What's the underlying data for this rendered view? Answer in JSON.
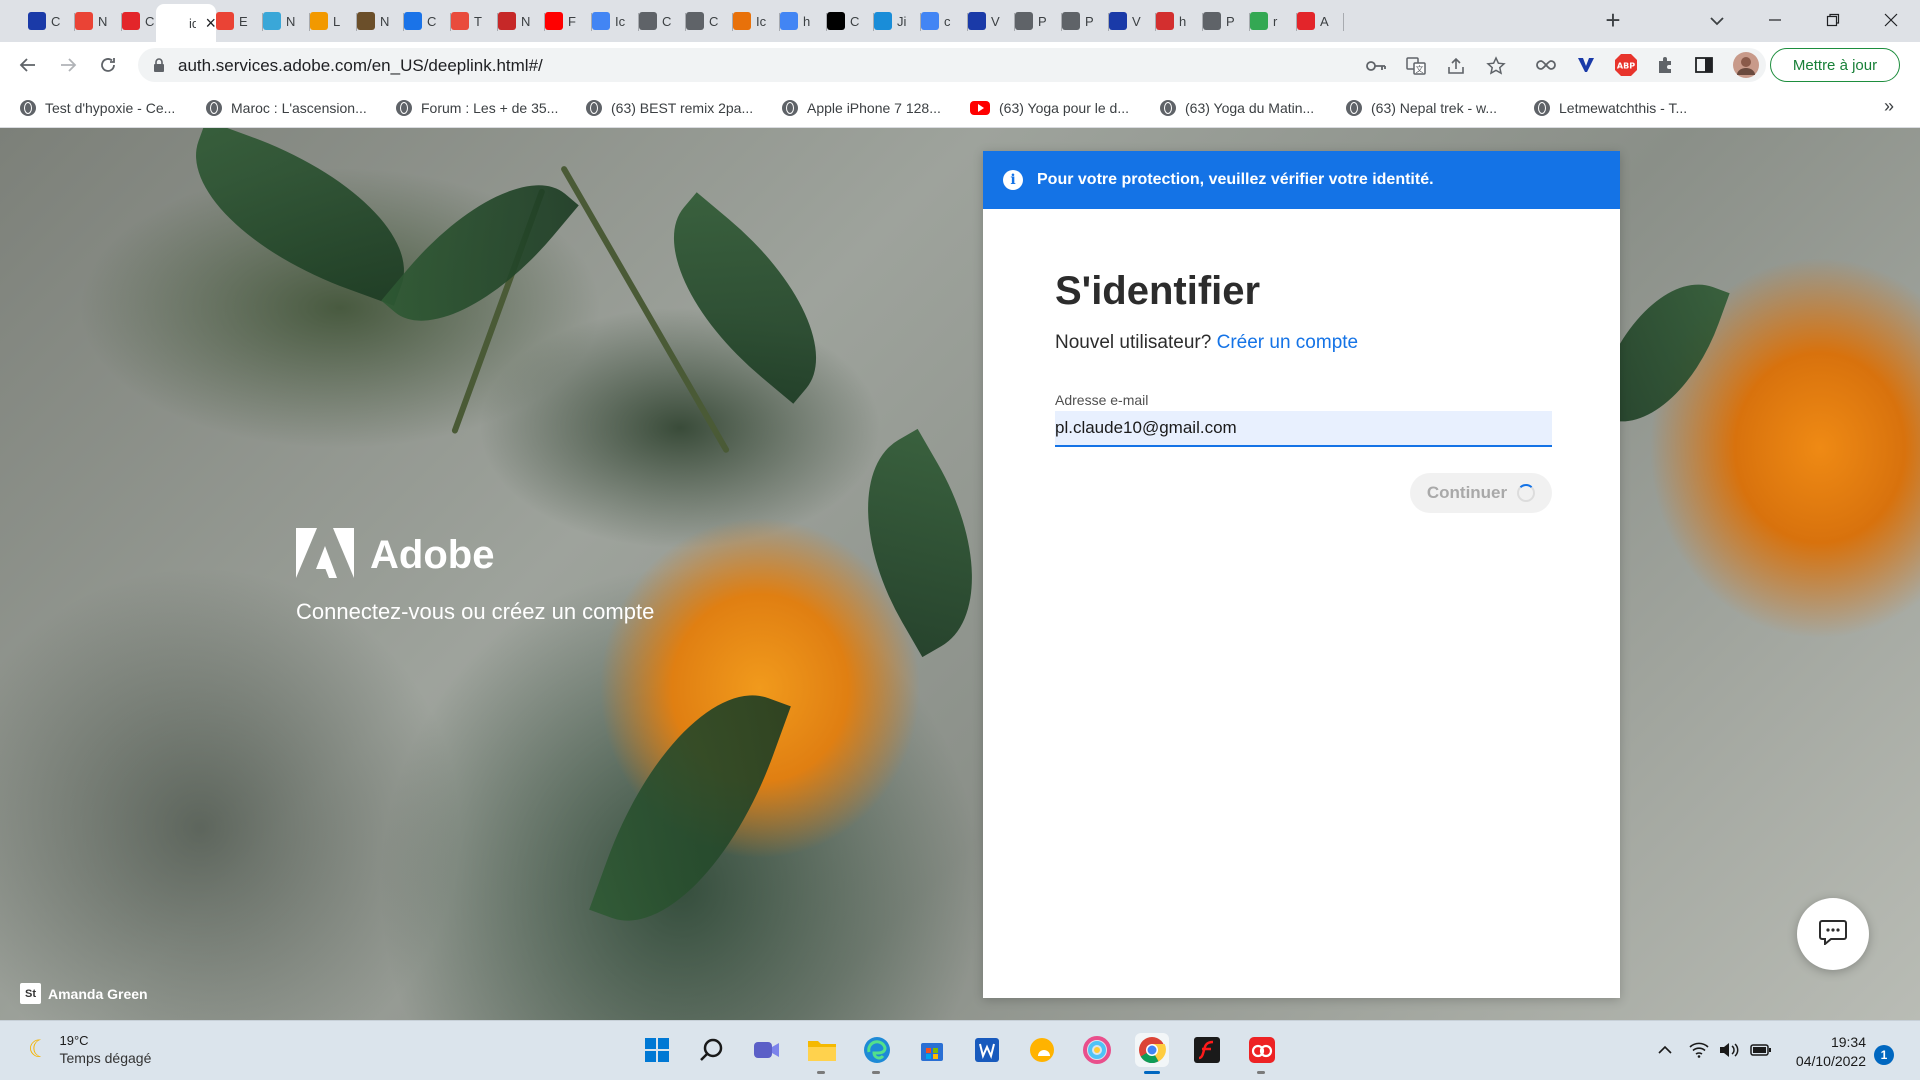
{
  "browser": {
    "tabs": [
      {
        "favicon": "veed-icon",
        "title": "C",
        "color": "#1a3aa8"
      },
      {
        "favicon": "gmail-icon",
        "title": "N",
        "color": "#ea4335"
      },
      {
        "favicon": "adobe-icon",
        "title": "C",
        "color": "#e3252a"
      },
      {
        "favicon": "text-icon",
        "title": "id",
        "color": "#ffffff",
        "active": true
      },
      {
        "favicon": "gmail-icon",
        "title": "E",
        "color": "#ea4335"
      },
      {
        "favicon": "plus-cross-icon",
        "title": "N",
        "color": "#3aa7d8"
      },
      {
        "favicon": "pencil-icon",
        "title": "L",
        "color": "#f29900"
      },
      {
        "favicon": "tree-icon",
        "title": "N",
        "color": "#6b4f2a"
      },
      {
        "favicon": "calendar-icon",
        "title": "C",
        "color": "#1a73e8"
      },
      {
        "favicon": "heart-icon",
        "title": "T",
        "color": "#e94b3c"
      },
      {
        "favicon": "swirl-icon",
        "title": "N",
        "color": "#c62828"
      },
      {
        "favicon": "youtube-icon",
        "title": "F",
        "color": "#ff0000"
      },
      {
        "favicon": "google-icon",
        "title": "Ic",
        "color": "#4285f4"
      },
      {
        "favicon": "ign-icon",
        "title": "C",
        "color": "#5f6368"
      },
      {
        "favicon": "ign-icon",
        "title": "C",
        "color": "#5f6368"
      },
      {
        "favicon": "image-icon",
        "title": "Ic",
        "color": "#e8710a"
      },
      {
        "favicon": "google-icon",
        "title": "h",
        "color": "#4285f4"
      },
      {
        "favicon": "wix-icon",
        "title": "C",
        "color": "#000000"
      },
      {
        "favicon": "five-icon",
        "title": "Ji",
        "color": "#1a8dd8"
      },
      {
        "favicon": "google-icon",
        "title": "c",
        "color": "#4285f4"
      },
      {
        "favicon": "veed-icon",
        "title": "V",
        "color": "#1a3aa8"
      },
      {
        "favicon": "globe-icon",
        "title": "P",
        "color": "#5f6368"
      },
      {
        "favicon": "globe-icon",
        "title": "P",
        "color": "#5f6368"
      },
      {
        "favicon": "veed-icon",
        "title": "V",
        "color": "#1a3aa8"
      },
      {
        "favicon": "flag-icon",
        "title": "h",
        "color": "#d32f2f"
      },
      {
        "favicon": "globe-icon",
        "title": "P",
        "color": "#5f6368"
      },
      {
        "favicon": "maps-icon",
        "title": "r",
        "color": "#34a853"
      },
      {
        "favicon": "adobe-icon",
        "title": "A",
        "color": "#e3252a"
      }
    ],
    "url": "auth.services.adobe.com/en_US/deeplink.html#/",
    "update_label": "Mettre à jour",
    "bookmarks": [
      {
        "icon": "globe-icon",
        "label": "Test d'hypoxie - Ce..."
      },
      {
        "icon": "globe-icon",
        "label": "Maroc : L'ascension..."
      },
      {
        "icon": "globe-icon",
        "label": "Forum : Les + de 35..."
      },
      {
        "icon": "globe-icon",
        "label": "(63) BEST remix 2pa..."
      },
      {
        "icon": "globe-icon",
        "label": "Apple iPhone 7 128..."
      },
      {
        "icon": "youtube-icon",
        "label": "(63) Yoga pour le d..."
      },
      {
        "icon": "globe-icon",
        "label": "(63) Yoga du Matin..."
      },
      {
        "icon": "globe-icon",
        "label": "(63) Nepal trek - w..."
      },
      {
        "icon": "globe-icon",
        "label": "Letmewatchthis - T..."
      }
    ],
    "bookmarks_more": "»"
  },
  "brand": {
    "name": "Adobe",
    "tagline": "Connectez-vous ou créez un compte",
    "photo_credit": "Amanda Green",
    "credit_badge": "St"
  },
  "signin": {
    "banner": "Pour votre protection, veuillez vérifier votre identité.",
    "title": "S'identifier",
    "new_user_prompt": "Nouvel utilisateur?",
    "create_account": "Créer un compte",
    "email_label": "Adresse e-mail",
    "email_value": "pl.claude10@gmail.com",
    "continue_label": "Continuer"
  },
  "taskbar": {
    "temperature": "19°C",
    "weather": "Temps dégagé",
    "time": "19:34",
    "date": "04/10/2022",
    "notifications": "1",
    "apps": [
      "windows-start-icon",
      "search-icon",
      "teams-icon",
      "file-explorer-icon",
      "edge-icon",
      "store-icon",
      "word-icon",
      "weather-app-icon",
      "photos-icon",
      "chrome-icon",
      "flash-icon",
      "creative-cloud-icon"
    ]
  }
}
